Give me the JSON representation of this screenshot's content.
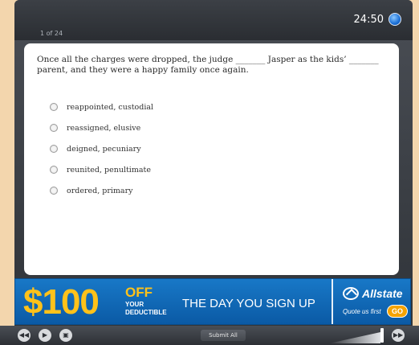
{
  "header": {
    "timer": "24:50",
    "counter": "1 of 24"
  },
  "question": {
    "text": "Once all the charges were dropped, the judge _______ Jasper as the kids’ _______ parent, and they were a happy family once again.",
    "options": [
      "reappointed, custodial",
      "reassigned, elusive",
      "deigned, pecuniary",
      "reunited, penultimate",
      "ordered, primary"
    ]
  },
  "ad": {
    "amount": "$100",
    "off": "OFF",
    "your": "YOUR",
    "deductible": "DEDUCTIBLE",
    "headline": "THE DAY YOU SIGN UP",
    "brand": "Allstate",
    "quote": "Quote us first",
    "go": "GO",
    "colors": {
      "accent": "#ffc21a",
      "background": "#1269b8",
      "go": "#f5a300"
    }
  },
  "footer": {
    "submit_label": "Submit All",
    "icons": [
      "rewind-icon",
      "play-icon",
      "document-icon",
      "fast-forward-icon"
    ]
  }
}
